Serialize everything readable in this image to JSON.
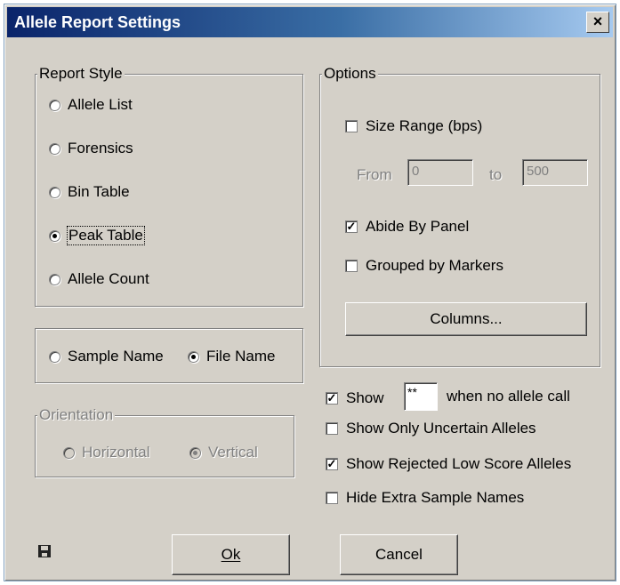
{
  "window": {
    "title": "Allele Report Settings",
    "close_label": "×"
  },
  "report_style": {
    "legend": "Report Style",
    "options": [
      {
        "label": "Allele List",
        "checked": false
      },
      {
        "label": "Forensics",
        "checked": false
      },
      {
        "label": "Bin Table",
        "checked": false
      },
      {
        "label": "Peak Table",
        "checked": true
      },
      {
        "label": "Allele Count",
        "checked": false
      }
    ]
  },
  "name_choice": {
    "options": [
      {
        "label": "Sample Name",
        "checked": false
      },
      {
        "label": "File Name",
        "checked": true
      }
    ]
  },
  "orientation": {
    "legend": "Orientation",
    "options": [
      {
        "label": "Horizontal",
        "checked": false
      },
      {
        "label": "Vertical",
        "checked": true
      }
    ]
  },
  "options": {
    "legend": "Options",
    "size_range": {
      "label": "Size Range (bps)",
      "checked": false
    },
    "from_label": "From",
    "from_value": "0",
    "to_label": "to",
    "to_value": "500",
    "abide_by_panel": {
      "label": "Abide By Panel",
      "checked": true
    },
    "grouped_by_markers": {
      "label": "Grouped by Markers",
      "checked": false
    },
    "columns_button": "Columns..."
  },
  "extra": {
    "show": {
      "label": "Show",
      "checked": true,
      "value": "**",
      "suffix": "when no allele call"
    },
    "show_only_uncertain": {
      "label": "Show Only Uncertain Alleles",
      "checked": false
    },
    "show_rejected": {
      "label": "Show Rejected Low Score Alleles",
      "checked": true
    },
    "hide_extra": {
      "label": "Hide Extra Sample Names",
      "checked": false
    }
  },
  "buttons": {
    "ok": "Ok",
    "cancel": "Cancel"
  },
  "icons": {
    "save": "floppy-disk-icon"
  }
}
